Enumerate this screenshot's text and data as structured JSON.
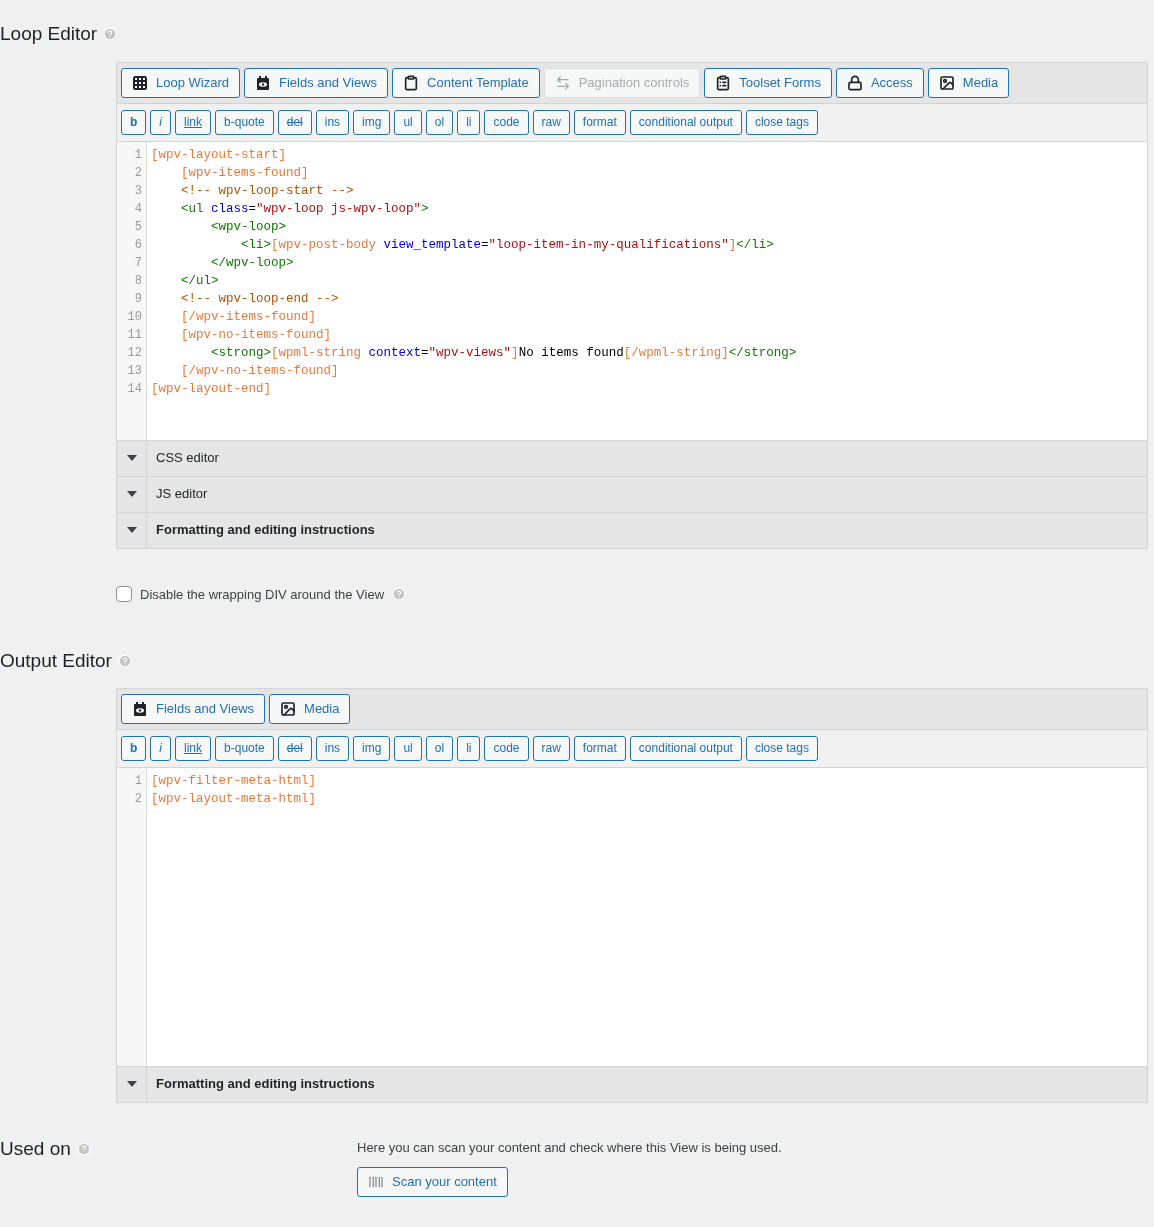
{
  "loop_editor": {
    "title": "Loop Editor",
    "media_buttons": [
      {
        "label": "Loop Wizard",
        "kind": "grid",
        "disabled": false
      },
      {
        "label": "Fields and Views",
        "kind": "fields",
        "disabled": false
      },
      {
        "label": "Content Template",
        "kind": "clipboard",
        "disabled": false
      },
      {
        "label": "Pagination controls",
        "kind": "pagination",
        "disabled": true
      },
      {
        "label": "Toolset Forms",
        "kind": "forms",
        "disabled": false
      },
      {
        "label": "Access",
        "kind": "lock",
        "disabled": false
      },
      {
        "label": "Media",
        "kind": "image",
        "disabled": false
      }
    ],
    "format_buttons": [
      {
        "label": "b",
        "kind": "bold"
      },
      {
        "label": "i",
        "kind": "italic"
      },
      {
        "label": "link",
        "kind": "underline"
      },
      {
        "label": "b-quote",
        "kind": "plain"
      },
      {
        "label": "del",
        "kind": "strike"
      },
      {
        "label": "ins",
        "kind": "plain"
      },
      {
        "label": "img",
        "kind": "plain"
      },
      {
        "label": "ul",
        "kind": "plain"
      },
      {
        "label": "ol",
        "kind": "plain"
      },
      {
        "label": "li",
        "kind": "plain"
      },
      {
        "label": "code",
        "kind": "plain"
      },
      {
        "label": "raw",
        "kind": "plain"
      },
      {
        "label": "format",
        "kind": "plain"
      },
      {
        "label": "conditional output",
        "kind": "plain"
      },
      {
        "label": "close tags",
        "kind": "plain"
      }
    ],
    "code_lines": [
      {
        "number": "1",
        "tokens": [
          {
            "kind": "shortcode",
            "text": "[wpv-layout-start]"
          }
        ]
      },
      {
        "number": "2",
        "tokens": [
          {
            "kind": "shortcode",
            "text": "    [wpv-items-found]"
          }
        ]
      },
      {
        "number": "3",
        "tokens": [
          {
            "kind": "comment",
            "text": "    <!-- wpv-loop-start -->"
          }
        ]
      },
      {
        "number": "4",
        "tokens": [
          {
            "kind": "tag",
            "text": "    <ul "
          },
          {
            "kind": "attr",
            "text": "class"
          },
          {
            "kind": "plain",
            "text": "="
          },
          {
            "kind": "string",
            "text": "\"wpv-loop js-wpv-loop\""
          },
          {
            "kind": "tag",
            "text": ">"
          }
        ]
      },
      {
        "number": "5",
        "tokens": [
          {
            "kind": "tag",
            "text": "        <wpv-loop>"
          }
        ]
      },
      {
        "number": "6",
        "tokens": [
          {
            "kind": "tag",
            "text": "            <li>"
          },
          {
            "kind": "shortcode",
            "text": "[wpv-post-body "
          },
          {
            "kind": "attr",
            "text": "view_template"
          },
          {
            "kind": "plain",
            "text": "="
          },
          {
            "kind": "string",
            "text": "\"loop-item-in-my-qualifications\""
          },
          {
            "kind": "shortcode",
            "text": "]"
          },
          {
            "kind": "tag",
            "text": "</li>"
          }
        ]
      },
      {
        "number": "7",
        "tokens": [
          {
            "kind": "tag",
            "text": "        </wpv-loop>"
          }
        ]
      },
      {
        "number": "8",
        "tokens": [
          {
            "kind": "tag",
            "text": "    </ul>"
          }
        ]
      },
      {
        "number": "9",
        "tokens": [
          {
            "kind": "comment",
            "text": "    <!-- wpv-loop-end -->"
          }
        ]
      },
      {
        "number": "10",
        "tokens": [
          {
            "kind": "shortcode",
            "text": "    [/wpv-items-found]"
          }
        ]
      },
      {
        "number": "11",
        "tokens": [
          {
            "kind": "shortcode",
            "text": "    [wpv-no-items-found]"
          }
        ]
      },
      {
        "number": "12",
        "tokens": [
          {
            "kind": "tag",
            "text": "        <strong>"
          },
          {
            "kind": "shortcode",
            "text": "[wpml-string "
          },
          {
            "kind": "attr",
            "text": "context"
          },
          {
            "kind": "plain",
            "text": "="
          },
          {
            "kind": "string",
            "text": "\"wpv-views\""
          },
          {
            "kind": "shortcode",
            "text": "]"
          },
          {
            "kind": "plain",
            "text": "No items found"
          },
          {
            "kind": "shortcode",
            "text": "[/wpml-string]"
          },
          {
            "kind": "tag",
            "text": "</strong>"
          }
        ]
      },
      {
        "number": "13",
        "tokens": [
          {
            "kind": "shortcode",
            "text": "    [/wpv-no-items-found]"
          }
        ]
      },
      {
        "number": "14",
        "tokens": [
          {
            "kind": "shortcode",
            "text": "[wpv-layout-end]"
          }
        ]
      }
    ],
    "panels": [
      {
        "label": "CSS editor",
        "bold": false,
        "expanded": false
      },
      {
        "label": "JS editor",
        "bold": false,
        "expanded": false
      },
      {
        "label": "Formatting and editing instructions",
        "bold": true,
        "expanded": false
      }
    ]
  },
  "wrapping_div": {
    "label": "Disable the wrapping DIV around the View",
    "checked": false
  },
  "output_editor": {
    "title": "Output Editor",
    "media_buttons": [
      {
        "label": "Fields and Views",
        "kind": "fields",
        "disabled": false
      },
      {
        "label": "Media",
        "kind": "image",
        "disabled": false
      }
    ],
    "format_buttons": [
      {
        "label": "b",
        "kind": "bold"
      },
      {
        "label": "i",
        "kind": "italic"
      },
      {
        "label": "link",
        "kind": "underline"
      },
      {
        "label": "b-quote",
        "kind": "plain"
      },
      {
        "label": "del",
        "kind": "strike"
      },
      {
        "label": "ins",
        "kind": "plain"
      },
      {
        "label": "img",
        "kind": "plain"
      },
      {
        "label": "ul",
        "kind": "plain"
      },
      {
        "label": "ol",
        "kind": "plain"
      },
      {
        "label": "li",
        "kind": "plain"
      },
      {
        "label": "code",
        "kind": "plain"
      },
      {
        "label": "raw",
        "kind": "plain"
      },
      {
        "label": "format",
        "kind": "plain"
      },
      {
        "label": "conditional output",
        "kind": "plain"
      },
      {
        "label": "close tags",
        "kind": "plain"
      }
    ],
    "code_lines": [
      {
        "number": "1",
        "tokens": [
          {
            "kind": "shortcode",
            "text": "[wpv-filter-meta-html]"
          }
        ]
      },
      {
        "number": "2",
        "tokens": [
          {
            "kind": "shortcode",
            "text": "[wpv-layout-meta-html]"
          }
        ]
      }
    ],
    "panels": [
      {
        "label": "Formatting and editing instructions",
        "bold": true,
        "expanded": false
      }
    ]
  },
  "used_on": {
    "title": "Used on",
    "description": "Here you can scan your content and check where this View is being used.",
    "button": "Scan your content"
  }
}
